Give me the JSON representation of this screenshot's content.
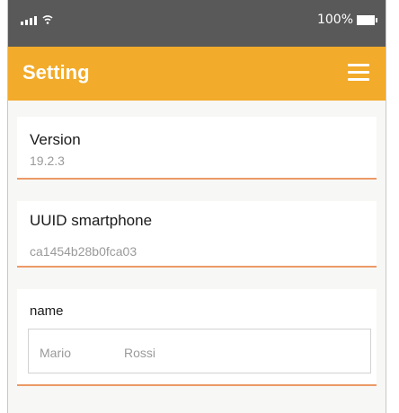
{
  "status_bar": {
    "battery_text": "100%",
    "icons": [
      "signal-icon",
      "wifi-icon",
      "battery-icon"
    ]
  },
  "app_bar": {
    "title": "Setting",
    "menu_icon": "menu-icon"
  },
  "settings": {
    "version": {
      "label": "Version",
      "value": "19.2.3"
    },
    "uuid": {
      "label": "UUID smartphone",
      "value": "ca1454b28b0fca03"
    },
    "name": {
      "label": "name",
      "first": "Mario",
      "last": "Rossi"
    }
  },
  "colors": {
    "app_bar": "#f2ab2a",
    "status_bar": "#595959",
    "underline": "#ec9a66"
  }
}
